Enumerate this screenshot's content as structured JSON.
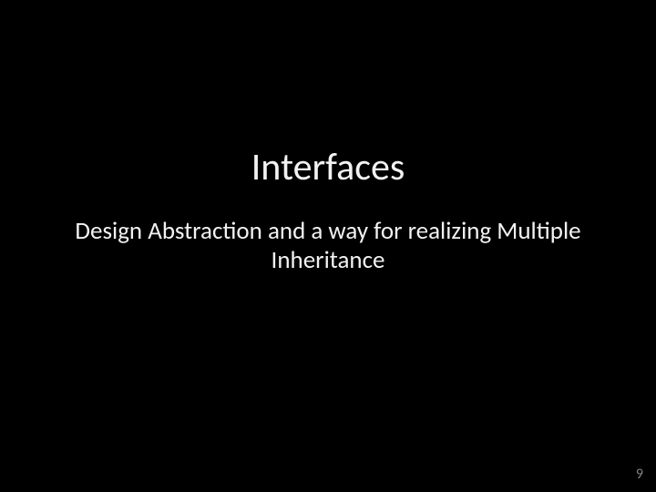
{
  "slide": {
    "title": "Interfaces",
    "subtitle": "Design Abstraction and a way for realizing Multiple Inheritance",
    "page_number": "9"
  }
}
